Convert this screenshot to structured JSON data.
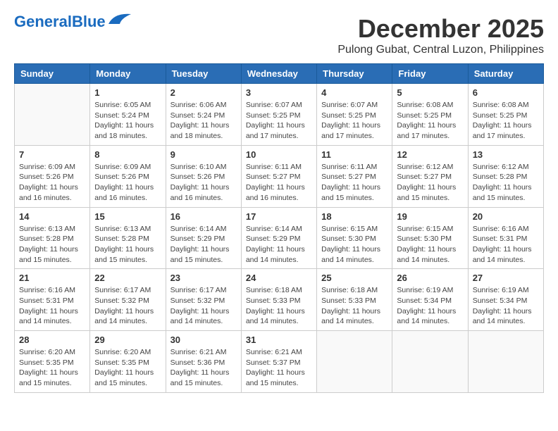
{
  "logo": {
    "part1": "General",
    "part2": "Blue"
  },
  "title": {
    "month": "December 2025",
    "location": "Pulong Gubat, Central Luzon, Philippines"
  },
  "headers": [
    "Sunday",
    "Monday",
    "Tuesday",
    "Wednesday",
    "Thursday",
    "Friday",
    "Saturday"
  ],
  "weeks": [
    [
      {
        "day": "",
        "info": ""
      },
      {
        "day": "1",
        "info": "Sunrise: 6:05 AM\nSunset: 5:24 PM\nDaylight: 11 hours\nand 18 minutes."
      },
      {
        "day": "2",
        "info": "Sunrise: 6:06 AM\nSunset: 5:24 PM\nDaylight: 11 hours\nand 18 minutes."
      },
      {
        "day": "3",
        "info": "Sunrise: 6:07 AM\nSunset: 5:25 PM\nDaylight: 11 hours\nand 17 minutes."
      },
      {
        "day": "4",
        "info": "Sunrise: 6:07 AM\nSunset: 5:25 PM\nDaylight: 11 hours\nand 17 minutes."
      },
      {
        "day": "5",
        "info": "Sunrise: 6:08 AM\nSunset: 5:25 PM\nDaylight: 11 hours\nand 17 minutes."
      },
      {
        "day": "6",
        "info": "Sunrise: 6:08 AM\nSunset: 5:25 PM\nDaylight: 11 hours\nand 17 minutes."
      }
    ],
    [
      {
        "day": "7",
        "info": "Sunrise: 6:09 AM\nSunset: 5:26 PM\nDaylight: 11 hours\nand 16 minutes."
      },
      {
        "day": "8",
        "info": "Sunrise: 6:09 AM\nSunset: 5:26 PM\nDaylight: 11 hours\nand 16 minutes."
      },
      {
        "day": "9",
        "info": "Sunrise: 6:10 AM\nSunset: 5:26 PM\nDaylight: 11 hours\nand 16 minutes."
      },
      {
        "day": "10",
        "info": "Sunrise: 6:11 AM\nSunset: 5:27 PM\nDaylight: 11 hours\nand 16 minutes."
      },
      {
        "day": "11",
        "info": "Sunrise: 6:11 AM\nSunset: 5:27 PM\nDaylight: 11 hours\nand 15 minutes."
      },
      {
        "day": "12",
        "info": "Sunrise: 6:12 AM\nSunset: 5:27 PM\nDaylight: 11 hours\nand 15 minutes."
      },
      {
        "day": "13",
        "info": "Sunrise: 6:12 AM\nSunset: 5:28 PM\nDaylight: 11 hours\nand 15 minutes."
      }
    ],
    [
      {
        "day": "14",
        "info": "Sunrise: 6:13 AM\nSunset: 5:28 PM\nDaylight: 11 hours\nand 15 minutes."
      },
      {
        "day": "15",
        "info": "Sunrise: 6:13 AM\nSunset: 5:28 PM\nDaylight: 11 hours\nand 15 minutes."
      },
      {
        "day": "16",
        "info": "Sunrise: 6:14 AM\nSunset: 5:29 PM\nDaylight: 11 hours\nand 15 minutes."
      },
      {
        "day": "17",
        "info": "Sunrise: 6:14 AM\nSunset: 5:29 PM\nDaylight: 11 hours\nand 14 minutes."
      },
      {
        "day": "18",
        "info": "Sunrise: 6:15 AM\nSunset: 5:30 PM\nDaylight: 11 hours\nand 14 minutes."
      },
      {
        "day": "19",
        "info": "Sunrise: 6:15 AM\nSunset: 5:30 PM\nDaylight: 11 hours\nand 14 minutes."
      },
      {
        "day": "20",
        "info": "Sunrise: 6:16 AM\nSunset: 5:31 PM\nDaylight: 11 hours\nand 14 minutes."
      }
    ],
    [
      {
        "day": "21",
        "info": "Sunrise: 6:16 AM\nSunset: 5:31 PM\nDaylight: 11 hours\nand 14 minutes."
      },
      {
        "day": "22",
        "info": "Sunrise: 6:17 AM\nSunset: 5:32 PM\nDaylight: 11 hours\nand 14 minutes."
      },
      {
        "day": "23",
        "info": "Sunrise: 6:17 AM\nSunset: 5:32 PM\nDaylight: 11 hours\nand 14 minutes."
      },
      {
        "day": "24",
        "info": "Sunrise: 6:18 AM\nSunset: 5:33 PM\nDaylight: 11 hours\nand 14 minutes."
      },
      {
        "day": "25",
        "info": "Sunrise: 6:18 AM\nSunset: 5:33 PM\nDaylight: 11 hours\nand 14 minutes."
      },
      {
        "day": "26",
        "info": "Sunrise: 6:19 AM\nSunset: 5:34 PM\nDaylight: 11 hours\nand 14 minutes."
      },
      {
        "day": "27",
        "info": "Sunrise: 6:19 AM\nSunset: 5:34 PM\nDaylight: 11 hours\nand 14 minutes."
      }
    ],
    [
      {
        "day": "28",
        "info": "Sunrise: 6:20 AM\nSunset: 5:35 PM\nDaylight: 11 hours\nand 15 minutes."
      },
      {
        "day": "29",
        "info": "Sunrise: 6:20 AM\nSunset: 5:35 PM\nDaylight: 11 hours\nand 15 minutes."
      },
      {
        "day": "30",
        "info": "Sunrise: 6:21 AM\nSunset: 5:36 PM\nDaylight: 11 hours\nand 15 minutes."
      },
      {
        "day": "31",
        "info": "Sunrise: 6:21 AM\nSunset: 5:37 PM\nDaylight: 11 hours\nand 15 minutes."
      },
      {
        "day": "",
        "info": ""
      },
      {
        "day": "",
        "info": ""
      },
      {
        "day": "",
        "info": ""
      }
    ]
  ]
}
